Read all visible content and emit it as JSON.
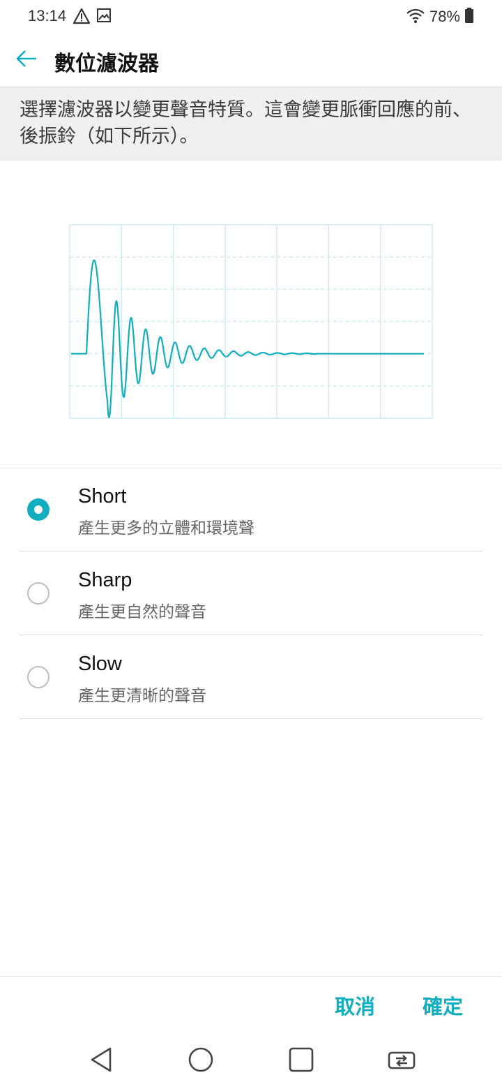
{
  "status_bar": {
    "time": "13:14",
    "battery": "78%",
    "left_icons": [
      "warning-icon",
      "image-icon"
    ],
    "right_icons": [
      "wifi-icon",
      "battery-icon"
    ]
  },
  "header": {
    "title": "數位濾波器",
    "back_icon": "arrow-left-icon"
  },
  "description": "選擇濾波器以變更聲音特質。這會變更脈衝回應的前、後振鈴（如下所示）。",
  "chart_data": {
    "type": "line",
    "grid": true,
    "color": "#10aebf",
    "description_of_signal": "impulse response with decaying ringing after the main peak",
    "series": [
      {
        "points": [
          [
            0,
            0
          ],
          [
            0.05,
            0.02
          ],
          [
            0.08,
            0.3
          ],
          [
            0.1,
            0.85
          ],
          [
            0.11,
            1.0
          ],
          [
            0.12,
            0.85
          ],
          [
            0.14,
            0.2
          ],
          [
            0.16,
            -0.6
          ],
          [
            0.17,
            -0.95
          ],
          [
            0.18,
            -0.7
          ],
          [
            0.2,
            0.2
          ],
          [
            0.21,
            0.55
          ],
          [
            0.22,
            0.2
          ],
          [
            0.23,
            -0.3
          ],
          [
            0.25,
            -0.05
          ],
          [
            0.26,
            0.3
          ],
          [
            0.28,
            -0.2
          ],
          [
            0.3,
            0.25
          ],
          [
            0.32,
            -0.15
          ],
          [
            0.34,
            0.2
          ],
          [
            0.36,
            -0.12
          ],
          [
            0.38,
            0.17
          ],
          [
            0.4,
            -0.1
          ],
          [
            0.42,
            0.13
          ],
          [
            0.44,
            -0.08
          ],
          [
            0.46,
            0.11
          ],
          [
            0.48,
            -0.06
          ],
          [
            0.5,
            0.08
          ],
          [
            0.52,
            -0.05
          ],
          [
            0.54,
            0.06
          ],
          [
            0.56,
            -0.04
          ],
          [
            0.58,
            0.04
          ],
          [
            0.6,
            -0.03
          ],
          [
            0.62,
            0.03
          ],
          [
            0.64,
            -0.02
          ],
          [
            0.66,
            0.02
          ],
          [
            0.68,
            -0.01
          ],
          [
            0.7,
            0.01
          ],
          [
            0.72,
            0
          ],
          [
            1.0,
            0
          ]
        ]
      }
    ]
  },
  "options": [
    {
      "title": "Short",
      "subtitle": "產生更多的立體和環境聲",
      "selected": true
    },
    {
      "title": "Sharp",
      "subtitle": "產生更自然的聲音",
      "selected": false
    },
    {
      "title": "Slow",
      "subtitle": "產生更清晰的聲音",
      "selected": false
    }
  ],
  "actions": {
    "cancel": "取消",
    "ok": "確定"
  },
  "nav": {
    "icons": [
      "back-triangle-icon",
      "home-circle-icon",
      "recents-square-icon",
      "switch-apps-icon"
    ]
  },
  "colors": {
    "accent": "#10aebf",
    "banner_bg": "#efefef"
  }
}
